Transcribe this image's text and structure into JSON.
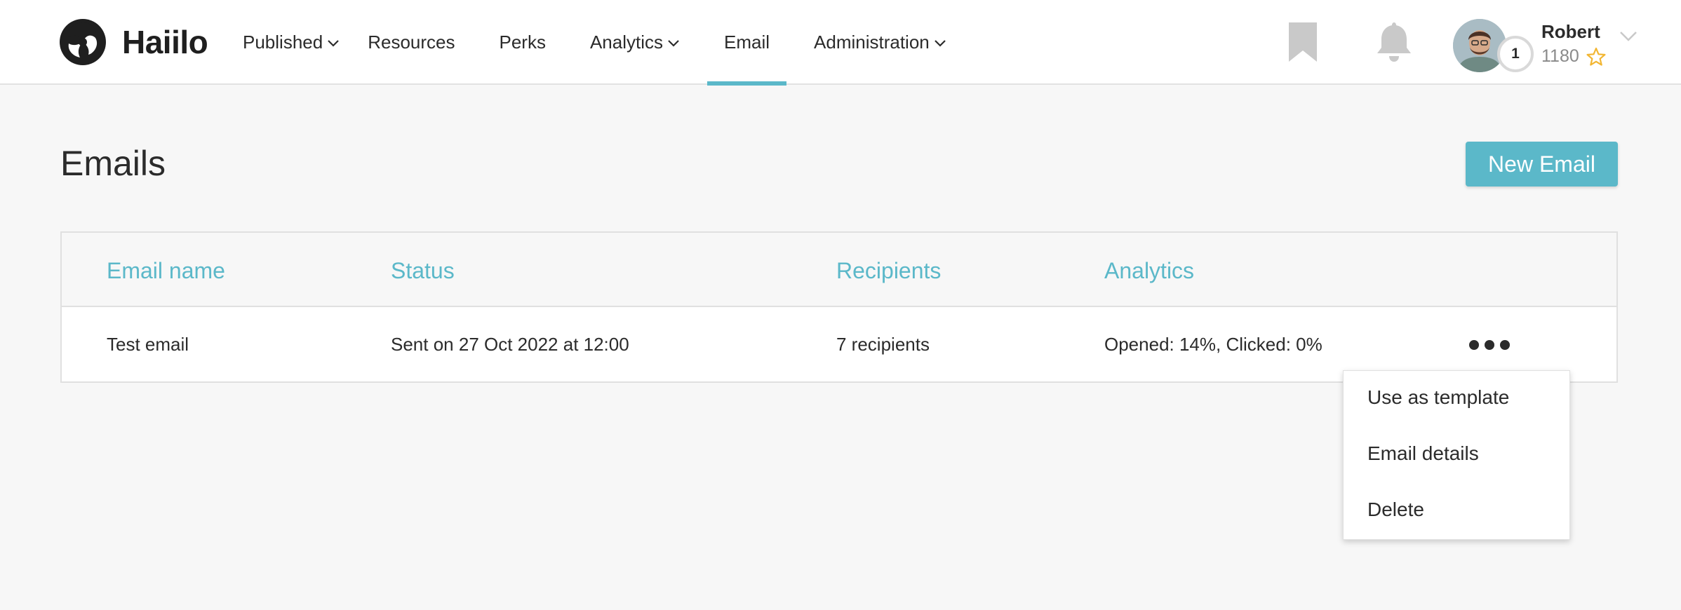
{
  "brand": {
    "name": "Haiilo"
  },
  "nav": {
    "items": [
      {
        "label": "Published",
        "dropdown": true
      },
      {
        "label": "Resources",
        "dropdown": false
      },
      {
        "label": "Perks",
        "dropdown": false
      },
      {
        "label": "Analytics",
        "dropdown": true
      },
      {
        "label": "Email",
        "dropdown": false,
        "active": true
      },
      {
        "label": "Administration",
        "dropdown": true
      }
    ]
  },
  "header_icons": [
    "bookmark-icon",
    "bell-icon"
  ],
  "user": {
    "name": "Robert",
    "points": "1180",
    "level": "1"
  },
  "page": {
    "title": "Emails",
    "new_button_label": "New Email"
  },
  "table": {
    "columns": [
      "Email name",
      "Status",
      "Recipients",
      "Analytics"
    ],
    "rows": [
      {
        "name": "Test email",
        "status": "Sent on 27 Oct 2022 at 12:00",
        "recipients": "7 recipients",
        "analytics": "Opened: 14%, Clicked: 0%"
      }
    ]
  },
  "row_menu": {
    "items": [
      "Use as template",
      "Email details",
      "Delete"
    ]
  },
  "colors": {
    "accent": "#5bb8c9",
    "text": "#2b2b2b",
    "muted": "#8a8a8a",
    "icon_gray": "#c9c9c9",
    "star": "#f2b632"
  }
}
